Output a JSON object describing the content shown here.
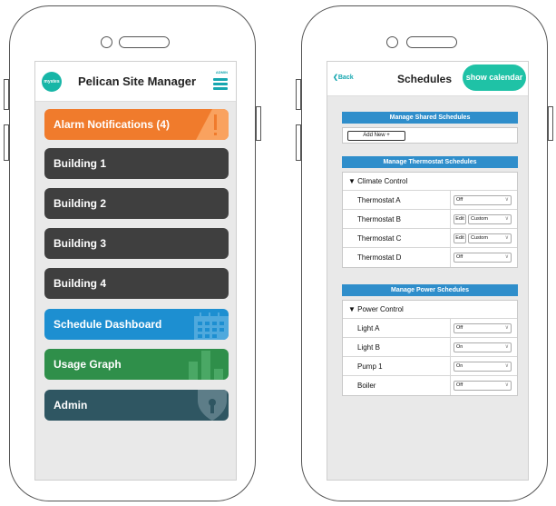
{
  "left_app": {
    "logo_text": "mystes",
    "title": "Pelican Site Manager",
    "admin_label": "ADMIN",
    "tiles": [
      {
        "label": "Alarm Notifications (4)",
        "color": "#f07b2c",
        "icon": "warning-icon"
      },
      {
        "label": "Building 1",
        "color": "#3f3f3f"
      },
      {
        "label": "Building 2",
        "color": "#3f3f3f"
      },
      {
        "label": "Building 3",
        "color": "#3f3f3f"
      },
      {
        "label": "Building 4",
        "color": "#3f3f3f"
      },
      {
        "label": "Schedule Dashboard",
        "color": "#1d8fd1",
        "icon": "calendar-icon"
      },
      {
        "label": "Usage Graph",
        "color": "#2f8f4a",
        "icon": "bar-graph-icon"
      },
      {
        "label": "Admin",
        "color": "#2f5662",
        "icon": "lock-icon"
      }
    ]
  },
  "right_app": {
    "back_label": "Back",
    "title": "Schedules",
    "calendar_button": "show calendar",
    "shared": {
      "header": "Manage Shared Schedules",
      "add_new": "Add New  +"
    },
    "thermostat": {
      "header": "Manage Thermostat Schedules",
      "group": "▼ Climate Control",
      "rows": [
        {
          "name": "Thermostat A",
          "edit": "",
          "value": "Off"
        },
        {
          "name": "Thermostat B",
          "edit": "Edit",
          "value": "Custom"
        },
        {
          "name": "Thermostat C",
          "edit": "Edit",
          "value": "Custom"
        },
        {
          "name": "Thermostat D",
          "edit": "",
          "value": "Off"
        }
      ]
    },
    "power": {
      "header": "Manage Power Schedules",
      "group": "▼ Power Control",
      "rows": [
        {
          "name": "Light A",
          "value": "Off"
        },
        {
          "name": "Light B",
          "value": "On"
        },
        {
          "name": "Pump 1",
          "value": "On"
        },
        {
          "name": "Boiler",
          "value": "Off"
        }
      ]
    }
  },
  "colors": {
    "accent": "#17a7b0",
    "calendar_button": "#1fc2a6",
    "section_header": "#2f8ecb"
  }
}
